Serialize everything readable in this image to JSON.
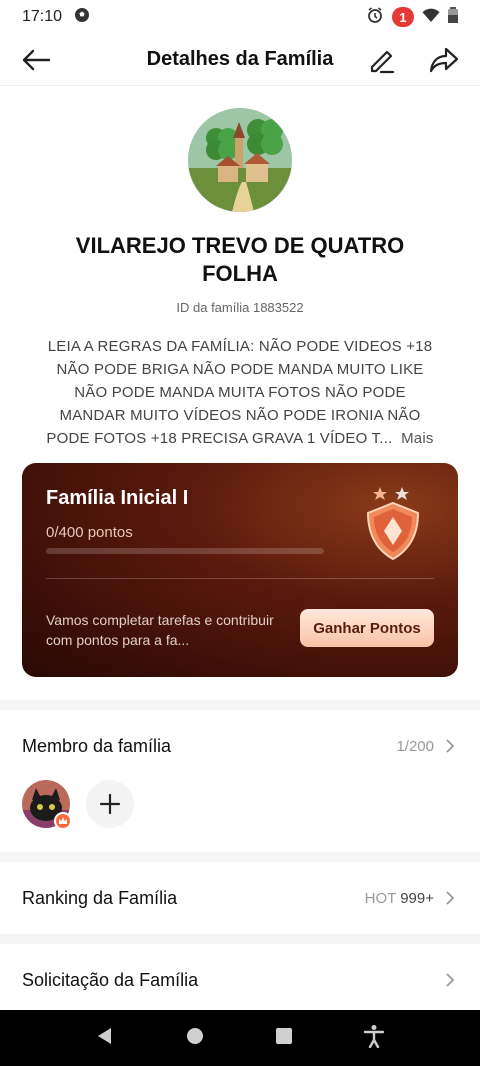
{
  "status": {
    "time": "17:10",
    "notifications": "1"
  },
  "header": {
    "title": "Detalhes da Família"
  },
  "family": {
    "name": "VILAREJO TREVO DE QUATRO FOLHA",
    "id_text": "ID da família 1883522",
    "description": "LEIA A REGRAS DA FAMÍLIA: NÃO PODE VIDEOS +18 NÃO PODE BRIGA NÃO PODE MANDA MUITO LIKE NÃO PODE MANDA MUITA FOTOS NÃO PODE MANDAR MUITO VÍDEOS NÃO PODE IRONIA NÃO PODE FOTOS +18  PRECISA GRAVA 1 VÍDEO T...",
    "more_label": "Mais"
  },
  "level": {
    "title": "Família Inicial I",
    "points_text": "0/400 pontos",
    "progress": 0,
    "hint": "Vamos completar tarefas e contribuir com pontos para a fa...",
    "button_label": "Ganhar Pontos"
  },
  "members": {
    "label": "Membro da família",
    "count": "1/200"
  },
  "ranking": {
    "label": "Ranking da Família",
    "hot_label": "HOT",
    "hot_value": "999+"
  },
  "request": {
    "label": "Solicitação da Família"
  }
}
